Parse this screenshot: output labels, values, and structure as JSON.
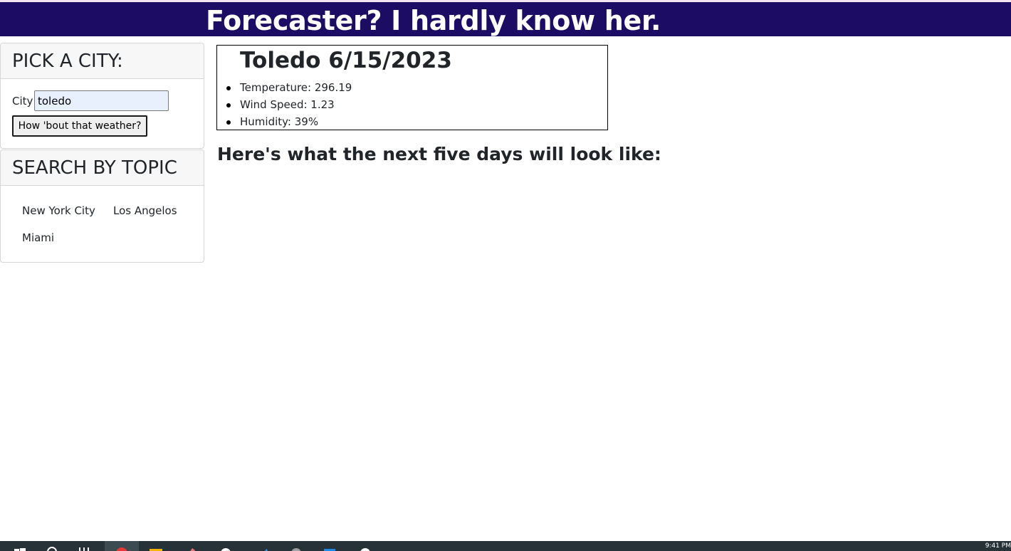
{
  "header": {
    "title": "Forecaster? I hardly know her."
  },
  "city_card": {
    "heading": "PICK A CITY:",
    "city_label": "City",
    "city_value": "toledo",
    "submit_label": "How 'bout that weather?"
  },
  "topic_card": {
    "heading": "SEARCH BY TOPIC",
    "topics": [
      "New York City",
      "Los Angelos",
      "Miami"
    ]
  },
  "today": {
    "title": "Toledo 6/15/2023",
    "stats": [
      "Temperature: 296.19",
      "Wind Speed: 1.23",
      "Humidity: 39%"
    ]
  },
  "forecast": {
    "title": "Here's what the next five days will look like:"
  },
  "taskbar": {
    "clock": "9:41 PM",
    "icons": [
      "start-icon",
      "search-icon",
      "task-view-icon",
      "chrome-icon",
      "file-explorer-icon",
      "paint-icon",
      "app-icon",
      "vscode-icon",
      "settings-icon",
      "calendar-icon",
      "clock-icon"
    ]
  },
  "colors": {
    "header_bg": "#1c0c63",
    "header_text": "#ffffff",
    "taskbar_bg": "#263238"
  }
}
